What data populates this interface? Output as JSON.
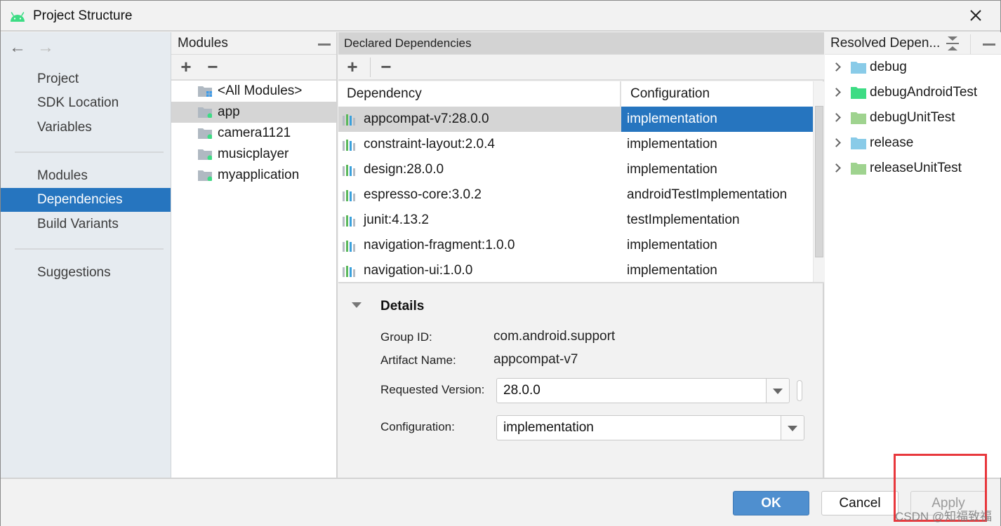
{
  "window": {
    "title": "Project Structure",
    "app_icon": "android-icon",
    "close_icon": "close-icon"
  },
  "nav": {
    "back_icon": "arrow-left-icon",
    "forward_icon": "arrow-right-icon",
    "groups": [
      [
        {
          "label": "Project"
        },
        {
          "label": "SDK Location"
        },
        {
          "label": "Variables"
        }
      ],
      [
        {
          "label": "Modules"
        },
        {
          "label": "Dependencies",
          "active": true
        },
        {
          "label": "Build Variants"
        }
      ],
      [
        {
          "label": "Suggestions"
        }
      ]
    ],
    "items": [
      "Project",
      "SDK Location",
      "Variables",
      "Modules",
      "Dependencies",
      "Build Variants",
      "Suggestions"
    ],
    "active_item": "Dependencies"
  },
  "modules": {
    "title": "Modules",
    "add_label": "+",
    "remove_label": "−",
    "items": [
      {
        "label": "<All Modules>",
        "icon": "all-modules-folder-icon",
        "selected": false
      },
      {
        "label": "app",
        "icon": "module-folder-icon",
        "selected": true
      },
      {
        "label": "camera1121",
        "icon": "module-folder-icon",
        "selected": false
      },
      {
        "label": "musicplayer",
        "icon": "module-folder-icon",
        "selected": false
      },
      {
        "label": "myapplication",
        "icon": "module-folder-icon",
        "selected": false
      }
    ]
  },
  "declared": {
    "title": "Declared Dependencies",
    "add_label": "+",
    "remove_label": "−",
    "columns": [
      "Dependency",
      "Configuration"
    ],
    "rows": [
      {
        "dependency": "appcompat-v7:28.0.0",
        "configuration": "implementation",
        "selected": true
      },
      {
        "dependency": "constraint-layout:2.0.4",
        "configuration": "implementation"
      },
      {
        "dependency": "design:28.0.0",
        "configuration": "implementation"
      },
      {
        "dependency": "espresso-core:3.0.2",
        "configuration": "androidTestImplementation"
      },
      {
        "dependency": "junit:4.13.2",
        "configuration": "testImplementation"
      },
      {
        "dependency": "navigation-fragment:1.0.0",
        "configuration": "implementation"
      },
      {
        "dependency": "navigation-ui:1.0.0",
        "configuration": "implementation"
      }
    ]
  },
  "details": {
    "title": "Details",
    "group_id_label": "Group ID:",
    "group_id": "com.android.support",
    "artifact_label": "Artifact Name:",
    "artifact": "appcompat-v7",
    "version_label": "Requested Version:",
    "version": "28.0.0",
    "configuration_label": "Configuration:",
    "configuration": "implementation"
  },
  "resolved": {
    "title": "Resolved Depen...",
    "items": [
      {
        "label": "debug",
        "color": "#89cbe8"
      },
      {
        "label": "debugAndroidTest",
        "color": "#3ddc84"
      },
      {
        "label": "debugUnitTest",
        "color": "#9fd38f"
      },
      {
        "label": "release",
        "color": "#89cbe8"
      },
      {
        "label": "releaseUnitTest",
        "color": "#9fd38f"
      }
    ]
  },
  "buttons": {
    "ok": "OK",
    "cancel": "Cancel",
    "apply": "Apply"
  },
  "watermark": "CSDN @知福致福",
  "colors": {
    "accent": "#2675bf",
    "ok_button": "#4f8fcf",
    "highlight_box": "#e8383d",
    "android_green": "#3ddc84"
  }
}
